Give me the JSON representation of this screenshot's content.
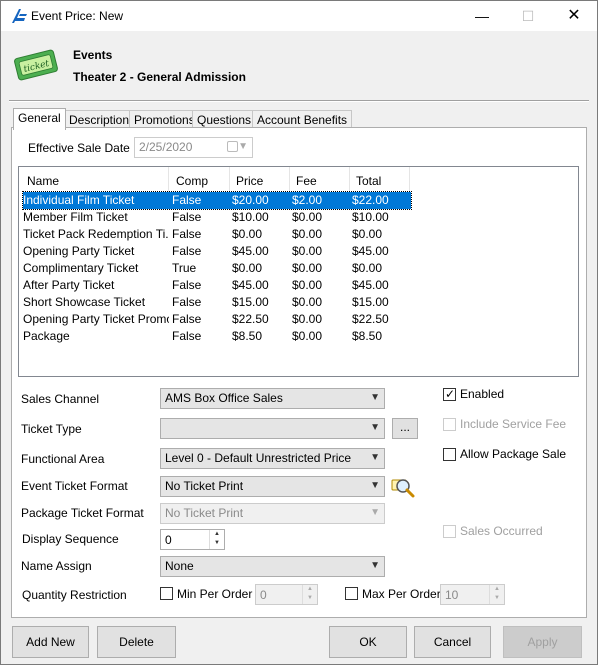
{
  "window": {
    "title": "Event Price: New",
    "min_glyph": "—",
    "max_glyph": "☐",
    "close_glyph": "✕"
  },
  "header": {
    "line1": "Events",
    "line2": "Theater 2 - General Admission",
    "icon_text": "ticket"
  },
  "tabs": [
    "General",
    "Description",
    "Promotions",
    "Questions",
    "Account Benefits"
  ],
  "effective_sale_date": {
    "label": "Effective Sale Date",
    "value": "2/25/2020"
  },
  "grid": {
    "columns": [
      "Name",
      "Comp",
      "Price",
      "Fee",
      "Total"
    ],
    "rows": [
      [
        "Individual Film Ticket",
        "False",
        "$20.00",
        "$2.00",
        "$22.00"
      ],
      [
        "Member Film Ticket",
        "False",
        "$10.00",
        "$0.00",
        "$10.00"
      ],
      [
        "Ticket Pack Redemption Ti...",
        "False",
        "$0.00",
        "$0.00",
        "$0.00"
      ],
      [
        "Opening Party Ticket",
        "False",
        "$45.00",
        "$0.00",
        "$45.00"
      ],
      [
        "Complimentary Ticket",
        "True",
        "$0.00",
        "$0.00",
        "$0.00"
      ],
      [
        "After Party Ticket",
        "False",
        "$45.00",
        "$0.00",
        "$45.00"
      ],
      [
        "Short Showcase Ticket",
        "False",
        "$15.00",
        "$0.00",
        "$15.00"
      ],
      [
        "Opening Party Ticket Promo",
        "False",
        "$22.50",
        "$0.00",
        "$22.50"
      ],
      [
        "Package",
        "False",
        "$8.50",
        "$0.00",
        "$8.50"
      ]
    ]
  },
  "form": {
    "sales_channel": {
      "label": "Sales Channel",
      "value": "AMS Box Office Sales"
    },
    "ticket_type": {
      "label": "Ticket Type",
      "value": "",
      "browse": "..."
    },
    "functional_area": {
      "label": "Functional Area",
      "value": "Level 0 - Default Unrestricted Price"
    },
    "event_ticket_format": {
      "label": "Event Ticket Format",
      "value": "No Ticket Print"
    },
    "package_ticket_format": {
      "label": "Package Ticket Format",
      "value": "No Ticket Print"
    },
    "display_sequence": {
      "label": "Display Sequence",
      "value": "0"
    },
    "name_assign": {
      "label": "Name Assign",
      "value": "None"
    },
    "quantity_restriction": {
      "label": "Quantity Restriction",
      "min_label": "Min Per Order",
      "min_value": "0",
      "max_label": "Max Per Order",
      "max_value": "10"
    }
  },
  "checks": {
    "enabled": "Enabled",
    "include_service_fee": "Include Service Fee",
    "allow_package_sale": "Allow Package Sale",
    "sales_occurred": "Sales Occurred"
  },
  "buttons": {
    "add_new": "Add New",
    "delete": "Delete",
    "ok": "OK",
    "cancel": "Cancel",
    "apply": "Apply"
  },
  "colors": {
    "selection": "#0078d7",
    "app_logo": "#1565c0",
    "ticket_icon": "#4caf50"
  }
}
